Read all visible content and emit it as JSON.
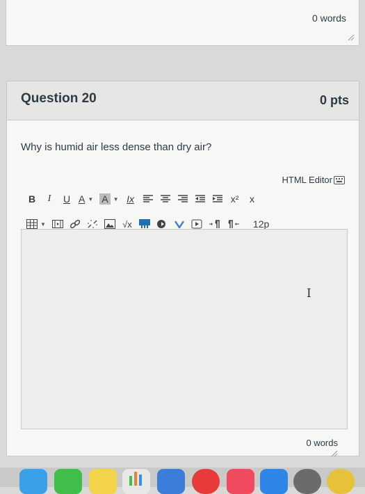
{
  "previous_question": {
    "word_count": "0 words"
  },
  "question": {
    "title": "Question 20",
    "points": "0 pts",
    "text": "Why is humid air less dense than dry air?"
  },
  "editor": {
    "html_editor_label": "HTML Editor",
    "toolbar": {
      "bold": "B",
      "italic": "I",
      "underline": "U",
      "font_color": "A",
      "background_color": "A",
      "clear_format": "Ix",
      "superscript": "x²",
      "subscript": "x",
      "font_size": "12p"
    },
    "word_count": "0 words"
  },
  "icons": [
    "finder-icon",
    "facetime-icon",
    "notes-icon",
    "numbers-icon",
    "keynote-icon",
    "news-icon",
    "music-icon",
    "app-store-icon",
    "settings-icon",
    "chrome-icon"
  ],
  "colors": {
    "background": "#d9d9d7",
    "panel": "#f7f7f6",
    "header": "#e6e6e4",
    "text": "#2d3b45"
  }
}
